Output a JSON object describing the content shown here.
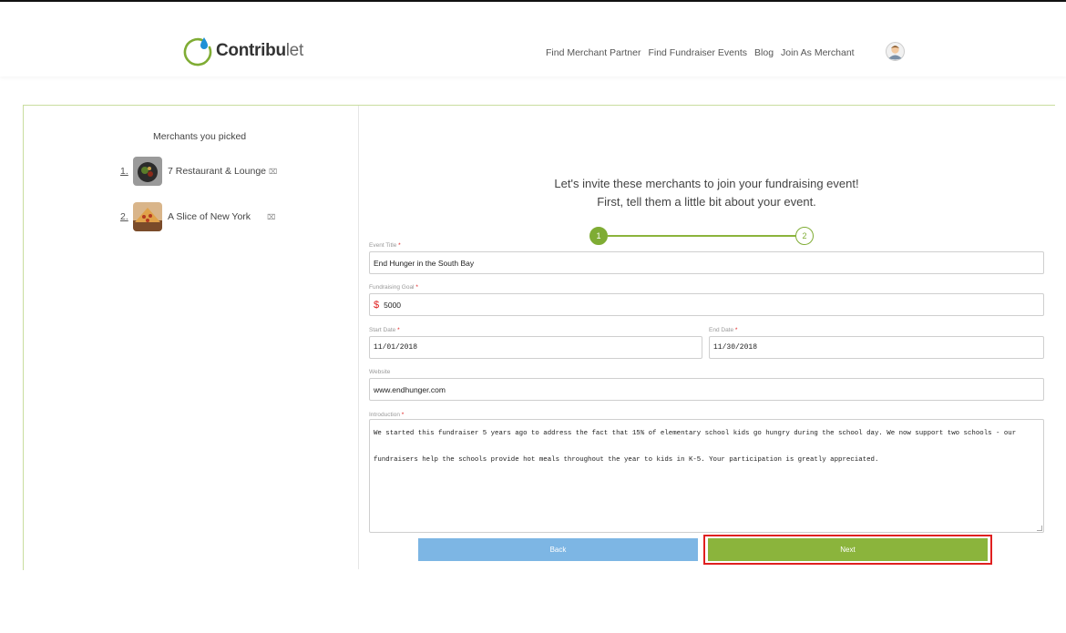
{
  "brand": {
    "bold": "Contribu",
    "light": "let",
    "accent": "#7fac34",
    "drop": "#1e90d6"
  },
  "nav": [
    "Find Merchant Partner",
    "Find Fundraiser Events",
    "Blog",
    "Join As Merchant"
  ],
  "sidebar": {
    "title": "Merchants you picked",
    "merchants": [
      {
        "num": "1.",
        "name": "7 Restaurant & Lounge",
        "remove_icon": "close-icon"
      },
      {
        "num": "2.",
        "name": "A Slice of New York",
        "remove_icon": "close-icon"
      }
    ]
  },
  "headline": {
    "line1": "Let's invite these merchants to join your fundraising event!",
    "line2": "First, tell them a little bit about your event."
  },
  "stepper": {
    "step1": "1",
    "step2": "2",
    "current": 1
  },
  "form": {
    "event_title": {
      "label": "Event Title",
      "value": "End Hunger in the South Bay"
    },
    "goal": {
      "label": "Fundraising Goal",
      "currency": "$",
      "value": "5000"
    },
    "start_date": {
      "label": "Start Date",
      "value": "11/01/2018"
    },
    "end_date": {
      "label": "End Date",
      "value": "11/30/2018"
    },
    "website": {
      "label": "Website",
      "value": "www.endhunger.com"
    },
    "introduction": {
      "label": "Introduction",
      "value": "We started this fundraiser 5 years ago to address the fact that 15% of elementary school kids go hungry during the school day. We now support two schools - our fundraisers help the schools provide hot meals throughout the year to kids in K-5. Your participation is greatly appreciated."
    },
    "required_mark": "*"
  },
  "buttons": {
    "back": "Back",
    "next": "Next"
  },
  "colors": {
    "back": "#7db6e4",
    "next": "#8bb43c",
    "highlight": "#e02020"
  }
}
